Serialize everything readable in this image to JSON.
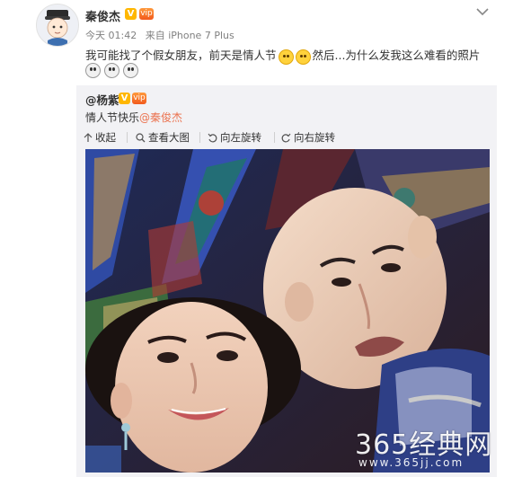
{
  "post": {
    "author": "秦俊杰",
    "badges": {
      "verified": "V",
      "vip": "vip"
    },
    "timestamp": "今天 01:42",
    "source": "来自 iPhone 7 Plus",
    "text_before_emoji": "我可能找了个假女朋友，前天是情人节",
    "text_after_emoji": "然后...为什么发我这么难看的照片",
    "emoji_icons": [
      "crying-face-icon",
      "crying-face-icon"
    ],
    "dog_emoji_icons": [
      "doge-icon",
      "doge-icon",
      "doge-icon"
    ]
  },
  "repost": {
    "author": "@杨紫",
    "text_prefix": "情人节快乐",
    "mention": "@秦俊杰",
    "toolbar": {
      "collapse": "收起",
      "view_large": "查看大图",
      "rotate_left": "向左旋转",
      "rotate_right": "向右旋转"
    }
  },
  "watermark": {
    "main": "365经典网",
    "url": "www.365jj.com"
  },
  "colors": {
    "mention": "#eb7350",
    "repost_bg": "#f2f2f5",
    "meta_text": "#808080"
  }
}
